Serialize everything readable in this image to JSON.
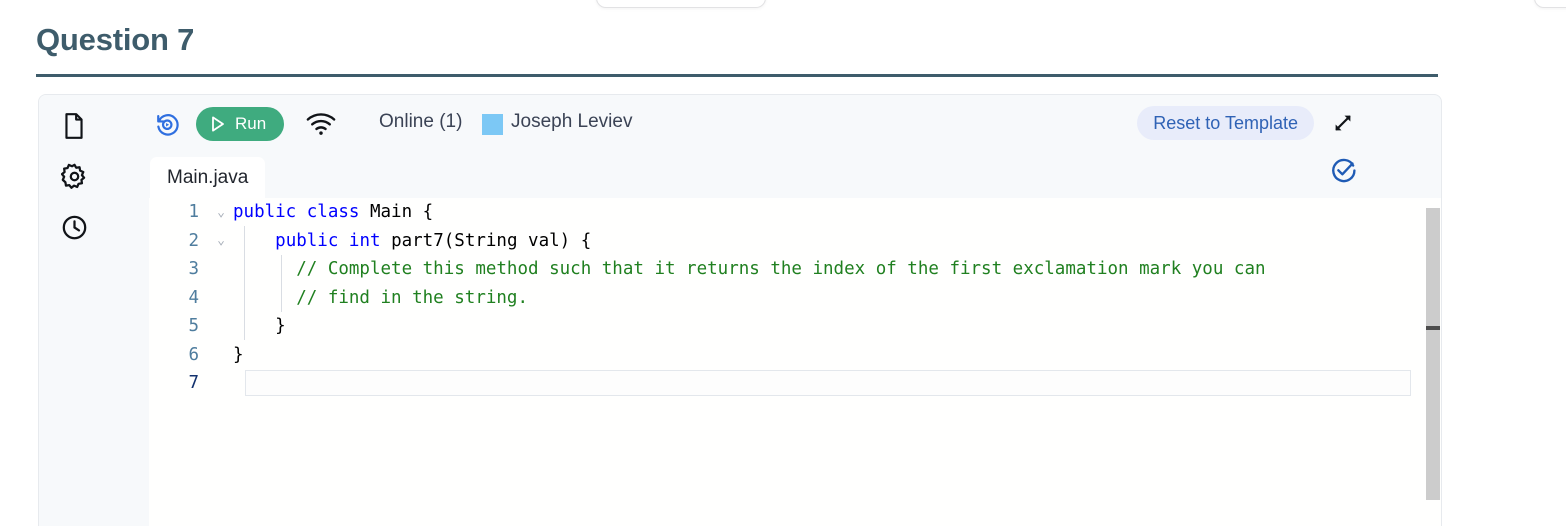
{
  "page": {
    "title": "Question 7"
  },
  "toolbar": {
    "new_file_icon": "file-icon",
    "settings_icon": "gear-icon",
    "history_icon": "clock-icon",
    "undo_icon": "undo-revert-icon",
    "run_label": "Run",
    "run_icon": "play-icon",
    "run_color": "#3fab7f",
    "wifi_icon": "wifi-icon",
    "online_label": "Online (1)",
    "user_swatch_color": "#7cc8f5",
    "user_name": "Joseph Leviev",
    "reset_label": "Reset to Template",
    "reset_color": "#2f62b5",
    "expand_icon": "expand-arrows-icon",
    "check_icon": "check-circle-icon",
    "check_color": "#1f5bb5"
  },
  "tabs": [
    {
      "label": "Main.java",
      "active": true
    }
  ],
  "editor": {
    "language": "java",
    "active_line": 7,
    "lines": [
      {
        "number": "1",
        "fold": "chevron-down-icon",
        "tokens": [
          {
            "t": "public",
            "c": "kw"
          },
          {
            "t": " ",
            "c": "pl"
          },
          {
            "t": "class",
            "c": "kw"
          },
          {
            "t": " Main {",
            "c": "id"
          }
        ]
      },
      {
        "number": "2",
        "fold": "chevron-down-icon",
        "tokens": [
          {
            "t": "    ",
            "c": "pl"
          },
          {
            "t": "public",
            "c": "kw"
          },
          {
            "t": " ",
            "c": "pl"
          },
          {
            "t": "int",
            "c": "kw"
          },
          {
            "t": " part7(String val) {",
            "c": "id"
          }
        ]
      },
      {
        "number": "3",
        "fold": "",
        "tokens": [
          {
            "t": "      ",
            "c": "pl"
          },
          {
            "t": "// Complete this method such that it returns the index of the first exclamation mark you can",
            "c": "cmt"
          }
        ]
      },
      {
        "number": "4",
        "fold": "",
        "tokens": [
          {
            "t": "      ",
            "c": "pl"
          },
          {
            "t": "// find in the string.",
            "c": "cmt"
          }
        ]
      },
      {
        "number": "5",
        "fold": "",
        "tokens": [
          {
            "t": "    }",
            "c": "id"
          }
        ]
      },
      {
        "number": "6",
        "fold": "",
        "tokens": [
          {
            "t": "}",
            "c": "id"
          }
        ]
      },
      {
        "number": "7",
        "fold": "",
        "tokens": []
      }
    ]
  },
  "scrollbar": {
    "thumb_color": "#cccccc",
    "marker_color": "#4d4d4d"
  }
}
